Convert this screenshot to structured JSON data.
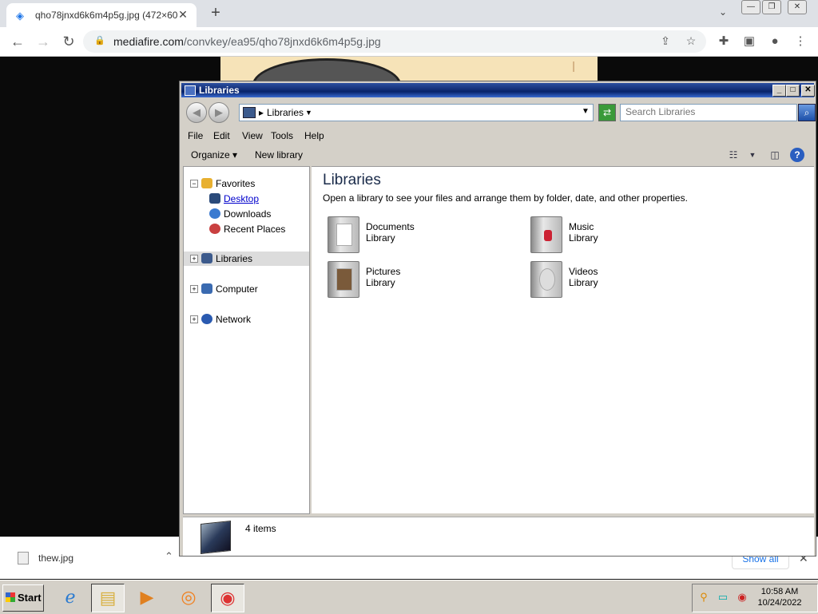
{
  "browser": {
    "tab_title": "qho78jnxd6k6m4p5g.jpg (472×600)",
    "url_domain": "mediafire.com",
    "url_path": "/convkey/ea95/qho78jnxd6k6m4p5g.jpg"
  },
  "downloads": {
    "file_name": "thew.jpg",
    "show_all": "Show all"
  },
  "explorer": {
    "title": "Libraries",
    "address_segment": "Libraries",
    "search_placeholder": "Search Libraries",
    "menu": [
      "File",
      "Edit",
      "View",
      "Tools",
      "Help"
    ],
    "commands": {
      "organize": "Organize",
      "new_library": "New library"
    },
    "nav": {
      "favorites": "Favorites",
      "desktop": "Desktop",
      "downloads": "Downloads",
      "recent": "Recent Places",
      "libraries": "Libraries",
      "computer": "Computer",
      "network": "Network"
    },
    "heading": "Libraries",
    "description": "Open a library to see your files and arrange them by folder, date, and other properties.",
    "libraries": [
      {
        "name": "Documents",
        "type": "Library"
      },
      {
        "name": "Music",
        "type": "Library"
      },
      {
        "name": "Pictures",
        "type": "Library"
      },
      {
        "name": "Videos",
        "type": "Library"
      }
    ],
    "status": "4 items"
  },
  "taskbar": {
    "start": "Start",
    "time": "10:58 AM",
    "date": "10/24/2022"
  }
}
